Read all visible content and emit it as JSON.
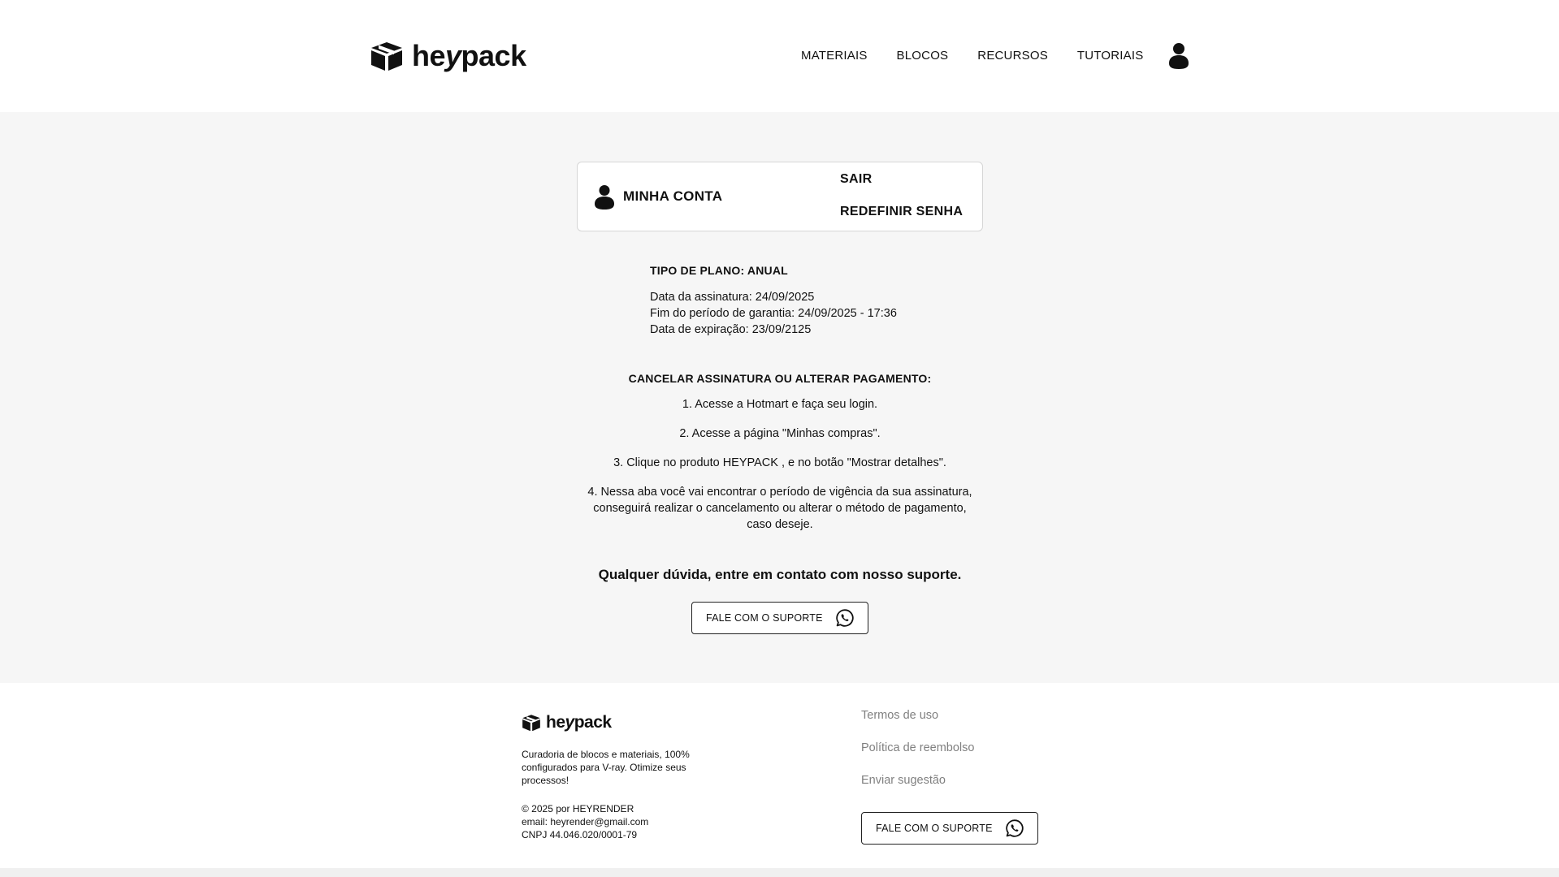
{
  "brand": {
    "logo_text_a": "he",
    "logo_text_y": "y",
    "logo_text_b": "pack"
  },
  "nav": {
    "items": [
      {
        "label": "MATERIAIS"
      },
      {
        "label": "BLOCOS"
      },
      {
        "label": "RECURSOS"
      },
      {
        "label": "TUTORIAIS"
      }
    ]
  },
  "account": {
    "title": "MINHA CONTA",
    "logout_label": "SAIR",
    "reset_password_label": "REDEFINIR SENHA"
  },
  "plan": {
    "type_label": "TIPO DE PLANO: ANUAL",
    "subscription_date": "Data da assinatura: 24/09/2025",
    "guarantee_end": "Fim do período de garantia: 24/09/2025 - 17:36",
    "expiration_date": "Data de expiração: 23/09/2125"
  },
  "cancel": {
    "title": "CANCELAR ASSINATURA OU ALTERAR PAGAMENTO:",
    "steps": [
      "1. Acesse a Hotmart e faça seu login.",
      "2. Acesse a página \"Minhas compras\".",
      "3. Clique no produto HEYPACK , e no botão \"Mostrar detalhes\".",
      "4. Nessa aba você vai encontrar o período de vigência da sua assinatura, conseguirá realizar o cancelamento ou alterar o método de pagamento, caso deseje."
    ]
  },
  "support": {
    "text": "Qualquer dúvida, entre em contato com nosso suporte.",
    "button_label": "FALE COM O SUPORTE",
    "icon": "whatsapp-icon"
  },
  "footer": {
    "description": "Curadoria de blocos e materiais, 100% configurados para V-ray. Otimize seus processos!",
    "copyright": "© 2025 por HEYRENDER",
    "email": "email: heyrender@gmail.com",
    "cnpj": "CNPJ 44.046.020/0001-79",
    "links": [
      {
        "label": "Termos de uso"
      },
      {
        "label": "Política de reembolso"
      },
      {
        "label": "Enviar sugestão"
      }
    ],
    "support_button_label": "FALE COM O SUPORTE"
  },
  "colors": {
    "background": "#f6f6f6",
    "surface": "#ffffff",
    "text": "#111111",
    "muted_link": "#808080",
    "border": "#d6d6d6"
  }
}
